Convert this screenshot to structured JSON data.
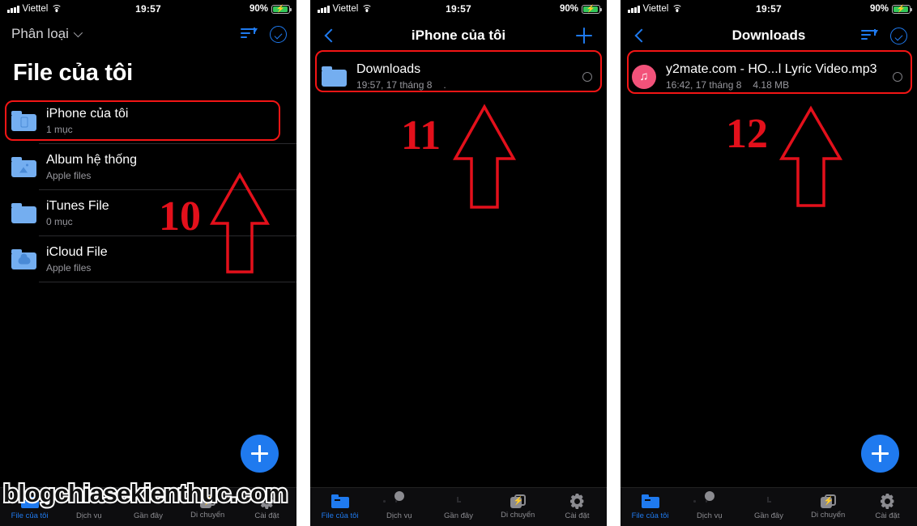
{
  "status": {
    "carrier": "Viettel",
    "time": "19:57",
    "battery_percent": "90%",
    "signal_icon": "cellular-bars-icon",
    "wifi_icon": "wifi-icon",
    "battery_icon": "battery-charging-icon"
  },
  "watermark": "blogchiasekienthuc.com",
  "panel1": {
    "sort_label": "Phân loại",
    "sort_icon": "sort-icon",
    "select_icon": "select-circle-check-icon",
    "title": "File của tôi",
    "items": [
      {
        "title": "iPhone của tôi",
        "sub": "1 mục",
        "icon": "folder-phone-icon",
        "highlighted": true
      },
      {
        "title": "Album hệ thống",
        "sub": "Apple files",
        "icon": "folder-photo-icon",
        "highlighted": false
      },
      {
        "title": "iTunes File",
        "sub": "0 mục",
        "icon": "folder-apple-icon",
        "highlighted": false
      },
      {
        "title": "iCloud File",
        "sub": "Apple files",
        "icon": "folder-cloud-icon",
        "highlighted": false
      }
    ],
    "fab_label": "+",
    "annotation_number": "10"
  },
  "panel2": {
    "back_icon": "back-chevron-icon",
    "title": "iPhone của tôi",
    "add_icon": "plus-icon",
    "items": [
      {
        "title": "Downloads",
        "date": "19:57, 17 tháng 8",
        "size": ".",
        "icon": "folder-plain-icon",
        "highlighted": true
      }
    ],
    "annotation_number": "11"
  },
  "panel3": {
    "back_icon": "back-chevron-icon",
    "title": "Downloads",
    "sort_icon": "sort-icon",
    "select_icon": "select-circle-check-icon",
    "items": [
      {
        "title": "y2mate.com - HO...l Lyric Video.mp3",
        "date": "16:42, 17 tháng 8",
        "size": "4.18 MB",
        "icon": "music-note-icon",
        "highlighted": true
      }
    ],
    "fab_label": "+",
    "annotation_number": "12"
  },
  "tabbar": {
    "items": [
      {
        "label": "File của tôi",
        "icon": "folder-tab-icon",
        "active": true
      },
      {
        "label": "Dịch vụ",
        "icon": "cloud-tab-icon",
        "active": false
      },
      {
        "label": "Gần đây",
        "icon": "clock-tab-icon",
        "active": false
      },
      {
        "label": "Di chuyển",
        "icon": "transfer-tab-icon",
        "active": false
      },
      {
        "label": "Cài đặt",
        "icon": "gear-tab-icon",
        "active": false
      }
    ]
  },
  "colors": {
    "accent_blue": "#1f7aef",
    "folder_blue": "#74aef0",
    "annotation_red": "#e3101b",
    "music_pink": "#f2527a",
    "battery_green": "#34c759"
  }
}
